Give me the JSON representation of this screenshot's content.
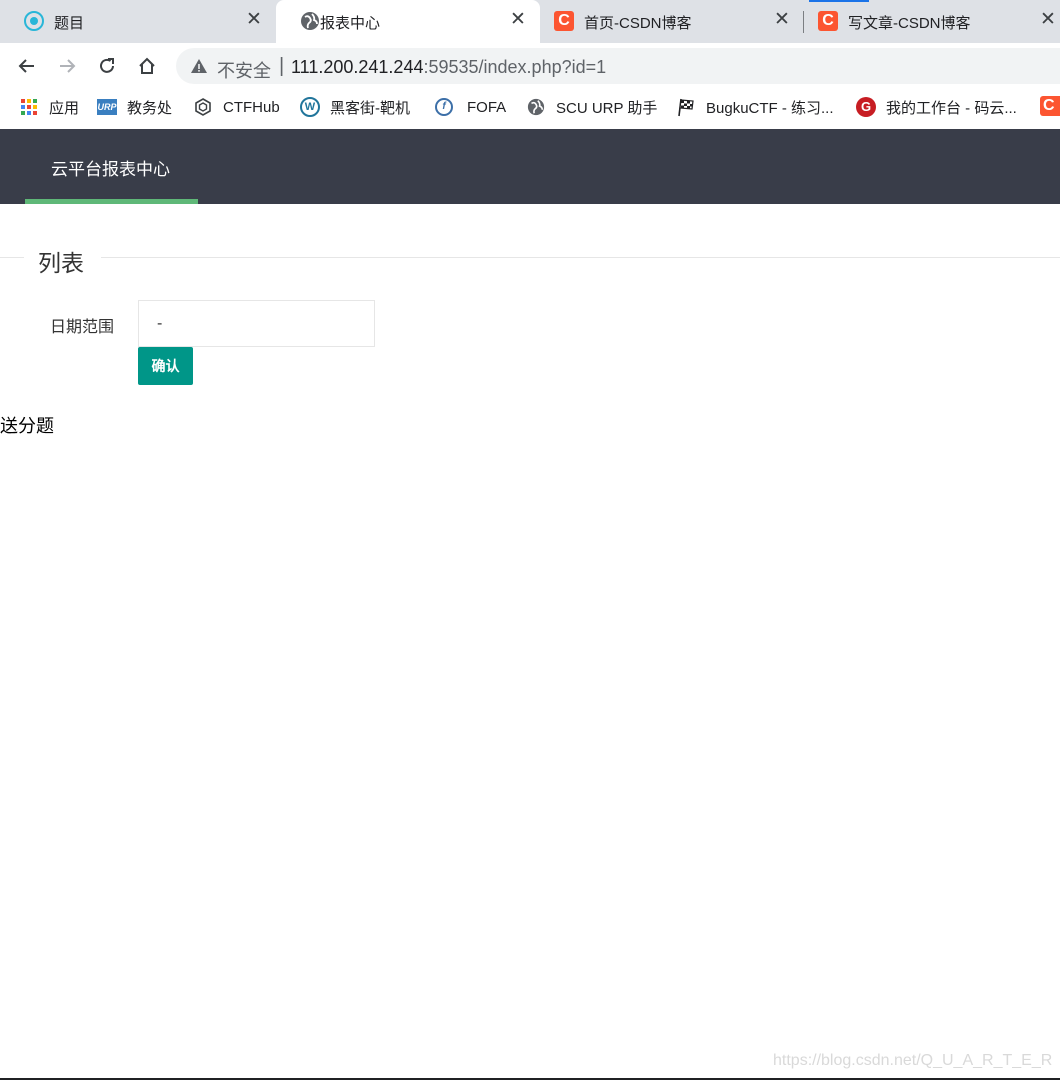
{
  "browser": {
    "tabs": [
      {
        "title": "题目",
        "icon": "site-globe-teal-icon",
        "close": "✕",
        "active": false
      },
      {
        "title": "报表中心",
        "icon": "globe-icon",
        "close": "✕",
        "active": true
      },
      {
        "title": "首页-CSDN博客",
        "icon": "csdn-icon",
        "close": "✕",
        "active": false
      },
      {
        "title": "写文章-CSDN博客",
        "icon": "csdn-icon",
        "close": "✕",
        "active": false
      }
    ],
    "address_bar": {
      "security_label": "不安全",
      "separator": "|",
      "url_host": "111.200.241.244",
      "url_rest": ":59535/index.php?id=1"
    },
    "bookmarks": [
      {
        "label": "应用",
        "icon": "apps-grid-icon"
      },
      {
        "label": "教务处",
        "icon": "urp-icon"
      },
      {
        "label": "CTFHub",
        "icon": "ctfhub-icon"
      },
      {
        "label": "黑客街-靶机",
        "icon": "wordpress-icon"
      },
      {
        "label": "FOFA",
        "icon": "fofa-icon"
      },
      {
        "label": "SCU URP 助手",
        "icon": "globe-icon"
      },
      {
        "label": "BugkuCTF - 练习...",
        "icon": "checkered-flag-icon"
      },
      {
        "label": "我的工作台 - 码云...",
        "icon": "gitee-icon"
      }
    ]
  },
  "page": {
    "header": {
      "nav_item": "云平台报表中心"
    },
    "fieldset_legend": "列表",
    "form": {
      "date_range_label": "日期范围",
      "date_range_value": "-",
      "confirm_button": "确认"
    },
    "body_text": "送分题"
  },
  "watermark": "https://blog.csdn.net/Q_U_A_R_T_E_R",
  "colors": {
    "header_bg": "#393d49",
    "nav_active_bar": "#5fb878",
    "confirm_button": "#009688"
  }
}
